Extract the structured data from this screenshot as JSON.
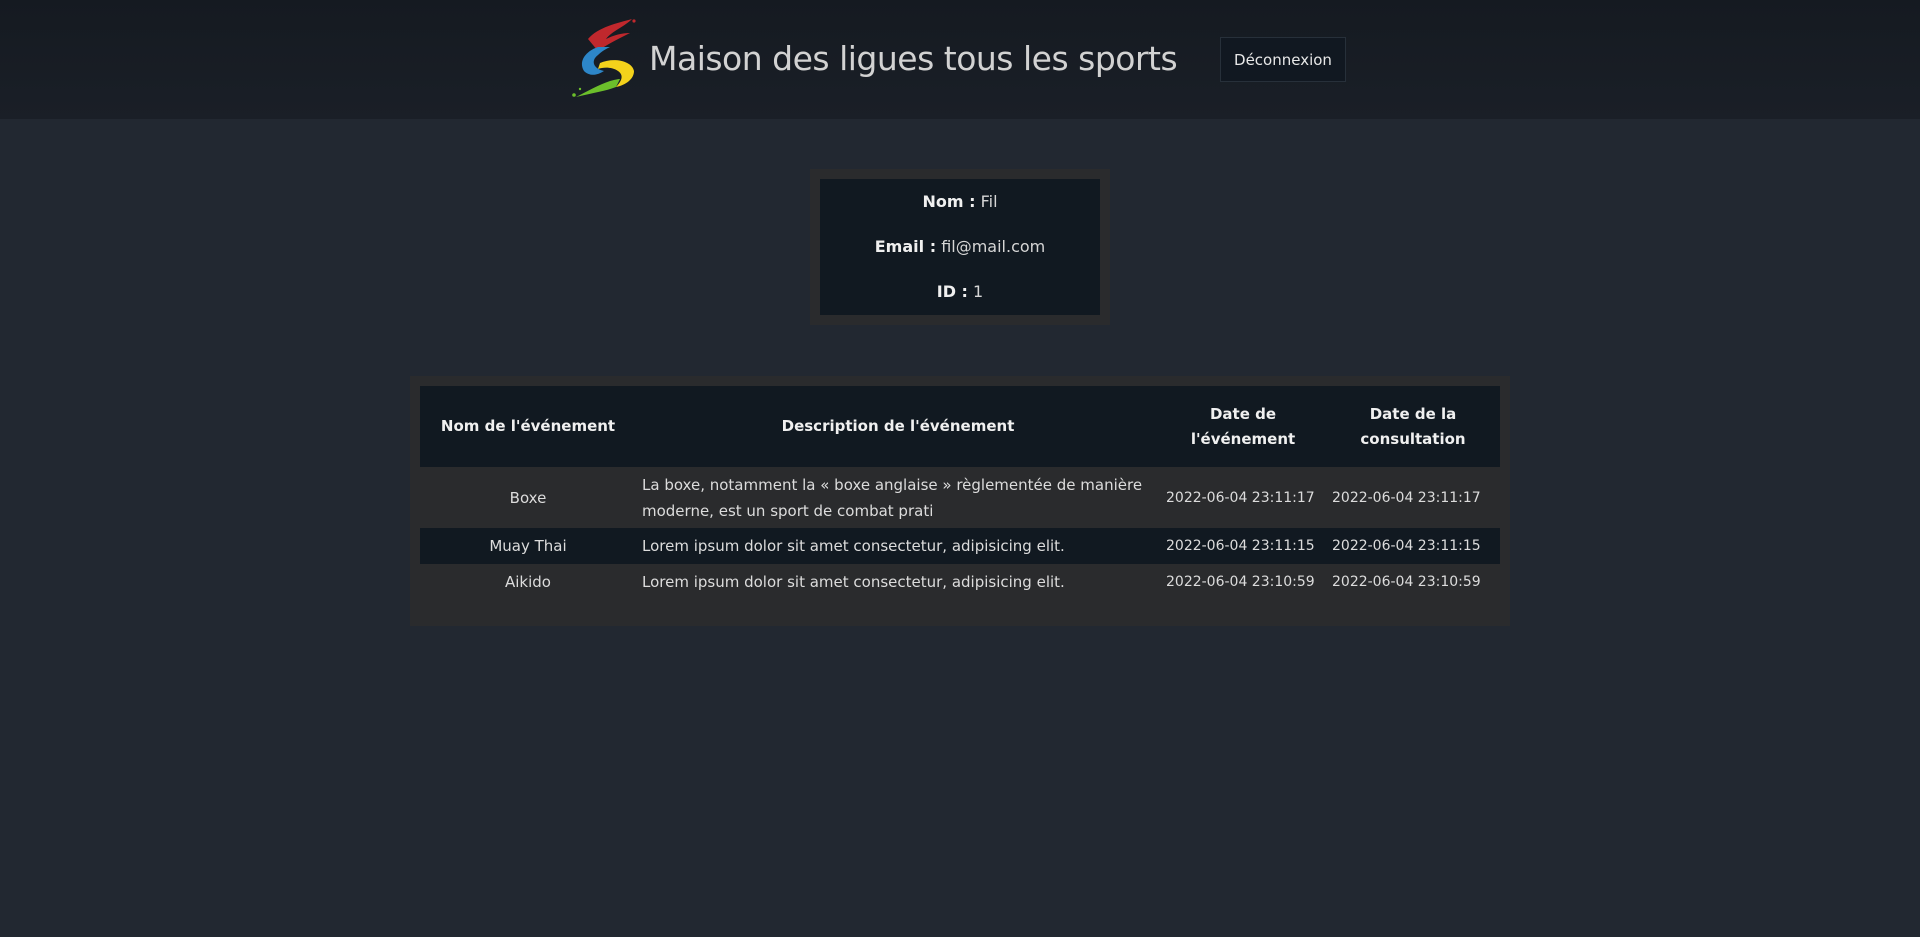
{
  "header": {
    "title": "Maison des ligues tous les sports",
    "logout_label": "Déconnexion",
    "logo_colors": [
      "#c0282d",
      "#2d86c8",
      "#f4d21b",
      "#6cbf2b"
    ]
  },
  "profile": {
    "name_label": "Nom :",
    "name_value": "Fil",
    "email_label": "Email :",
    "email_value": "fil@mail.com",
    "id_label": "ID :",
    "id_value": "1"
  },
  "events_table": {
    "columns": [
      "Nom de l'événement",
      "Description de l'événement",
      "Date de l'événement",
      "Date de la consultation"
    ],
    "rows": [
      {
        "name": "Boxe",
        "description": "La boxe, notamment la « boxe anglaise » règlementée de manière moderne, est un sport de combat prati",
        "event_date": "2022-06-04 23:11:17",
        "consult_date": "2022-06-04 23:11:17"
      },
      {
        "name": "Muay Thai",
        "description": "Lorem ipsum dolor sit amet consectetur, adipisicing elit.",
        "event_date": "2022-06-04 23:11:15",
        "consult_date": "2022-06-04 23:11:15"
      },
      {
        "name": "Aikido",
        "description": "Lorem ipsum dolor sit amet consectetur, adipisicing elit.",
        "event_date": "2022-06-04 23:10:59",
        "consult_date": "2022-06-04 23:10:59"
      }
    ]
  }
}
